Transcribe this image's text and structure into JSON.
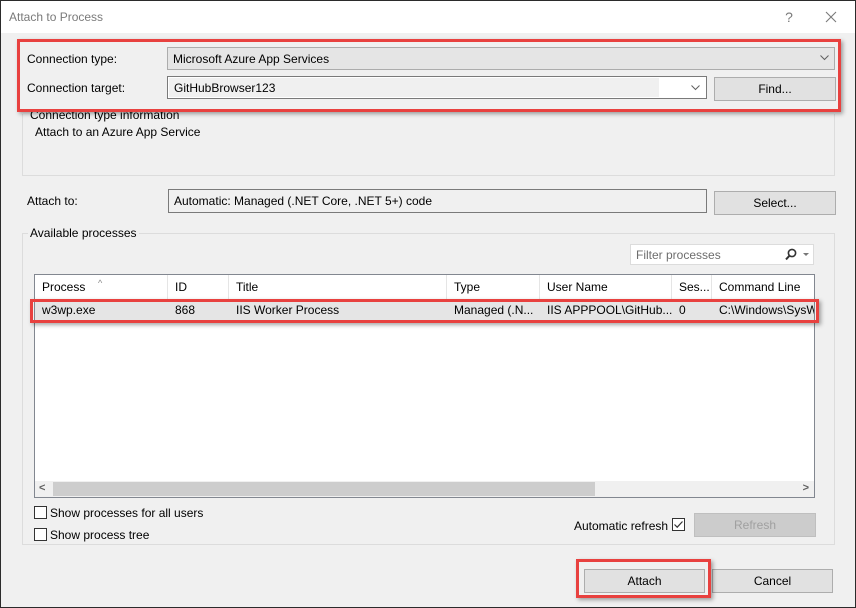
{
  "window": {
    "title": "Attach to Process",
    "help_icon": "question-mark-icon",
    "close_icon": "close-icon"
  },
  "connection": {
    "type_label": "Connection type:",
    "type_value": "Microsoft Azure App Services",
    "target_label": "Connection target:",
    "target_value": "GitHubBrowser123",
    "find_button": "Find..."
  },
  "connection_info": {
    "group_label": "Connection type information",
    "text": "Attach to an Azure App Service"
  },
  "attach_to": {
    "label": "Attach to:",
    "value": "Automatic: Managed (.NET Core, .NET 5+) code",
    "select_button": "Select..."
  },
  "processes": {
    "group_label": "Available processes",
    "filter_placeholder": "Filter processes",
    "filter_icon": "search-icon",
    "columns": [
      "Process",
      "ID",
      "Title",
      "Type",
      "User Name",
      "Ses...",
      "Command Line"
    ],
    "sorted_column": "Process",
    "rows": [
      {
        "process": "w3wp.exe",
        "id": "868",
        "title": "IIS Worker Process",
        "type": "Managed (.N...",
        "user_name": "IIS APPPOOL\\GitHub...",
        "session": "0",
        "command_line": "C:\\Windows\\SysW"
      }
    ]
  },
  "options": {
    "show_all_users_label": "Show processes for all users",
    "show_all_users_checked": false,
    "show_tree_label": "Show process tree",
    "show_tree_checked": false,
    "auto_refresh_label": "Automatic refresh",
    "auto_refresh_checked": true,
    "refresh_button": "Refresh"
  },
  "footer": {
    "attach_button": "Attach",
    "cancel_button": "Cancel"
  },
  "colors": {
    "highlight": "#e8413f"
  }
}
